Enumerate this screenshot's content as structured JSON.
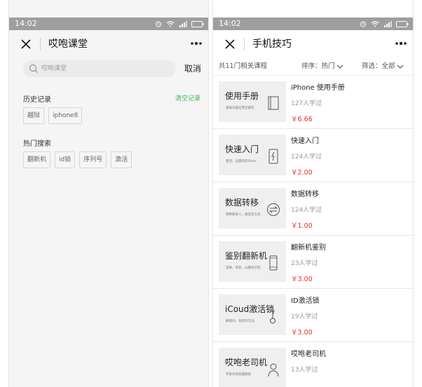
{
  "left": {
    "status": {
      "time": "14:02"
    },
    "nav": {
      "title": "哎咆课堂"
    },
    "search": {
      "placeholder": "哎咆课堂",
      "cancel_label": "取消"
    },
    "history": {
      "title": "历史记录",
      "clear_label": "清空记录",
      "tags": [
        "越狱",
        "iphone8"
      ]
    },
    "hot": {
      "title": "热门搜索",
      "tags": [
        "翻新机",
        "id锁",
        "序列号",
        "激活"
      ]
    }
  },
  "right": {
    "status": {
      "time": "14:02"
    },
    "nav": {
      "title": "手机技巧"
    },
    "filter": {
      "count_label": "共11门相关课程",
      "sort_label": "排序：热门",
      "filter_label": "筛选：全部"
    },
    "courses": [
      {
        "thumb_title": "使用手册",
        "thumb_sub": "基础功能应用全都有",
        "icon": "book-icon",
        "name": "iPhone 使用手册",
        "learners": "127人学过",
        "price": "￥6.66"
      },
      {
        "thumb_title": "快速入门",
        "thumb_sub": "激活、设置新的iPone",
        "icon": "phone-lightning-icon",
        "name": "快速入门",
        "learners": "124人学过",
        "price": "￥2.00"
      },
      {
        "thumb_title": "数据转移",
        "thumb_sub": "转移联系人、通话及方式",
        "icon": "transfer-arrows-icon",
        "name": "数据转移",
        "learners": "124人学过",
        "price": "￥1.00"
      },
      {
        "thumb_title": "鉴别翻新机",
        "thumb_sub": "官换、黑机、山寨机识别",
        "icon": "phone-icon",
        "name": "翻新机鉴别",
        "learners": "23人学过",
        "price": "￥3.00"
      },
      {
        "thumb_title": "iCoud激活锁",
        "thumb_sub": "解锁ID、找回ID方法",
        "icon": "key-icon",
        "name": "ID激活锁",
        "learners": "19人学过",
        "price": "￥3.00"
      },
      {
        "thumb_title": "哎咆老司机",
        "thumb_sub": "专家为你答疑解惑",
        "icon": "person-icon",
        "name": "哎咆老司机",
        "learners": "13人学过",
        "price": ""
      }
    ]
  },
  "colors": {
    "accent_green": "#3eae5b",
    "price_red": "#e0362c",
    "status_bar": "#9e9e9e"
  }
}
